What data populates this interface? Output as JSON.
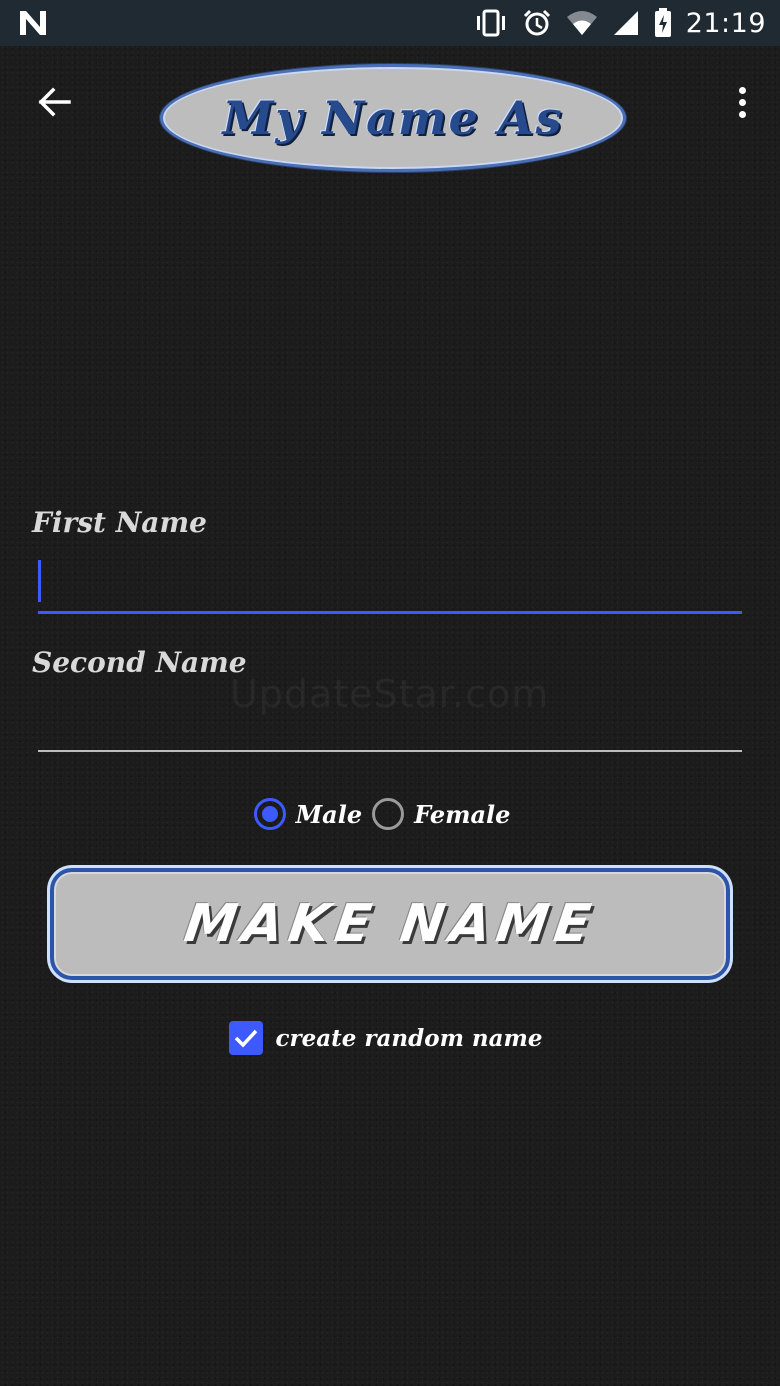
{
  "status_bar": {
    "time": "21:19",
    "icons": [
      "n-logo-icon",
      "vibrate-icon",
      "alarm-icon",
      "wifi-icon",
      "signal-icon",
      "battery-charging-icon"
    ]
  },
  "toolbar": {
    "back_icon": "arrow-left-icon",
    "logo_text": "My Name As",
    "menu_icon": "overflow-menu-icon"
  },
  "form": {
    "first_name": {
      "label": "First Name",
      "value": "",
      "placeholder": ""
    },
    "second_name": {
      "label": "Second Name",
      "value": "",
      "placeholder": ""
    },
    "watermark": "UpdateStar.com",
    "gender": {
      "options": [
        "Male",
        "Female"
      ],
      "selected": "Male"
    },
    "make_button_label": "MAKE NAME",
    "random_checkbox": {
      "label": "create random name",
      "checked": true
    }
  },
  "colors": {
    "accent": "#3d5afe",
    "logo_border": "#4b6fb5",
    "logo_text": "#274a8c",
    "button_face": "#bcbcbc",
    "status_bar": "#1f2a33",
    "background": "#1c1c1c"
  }
}
